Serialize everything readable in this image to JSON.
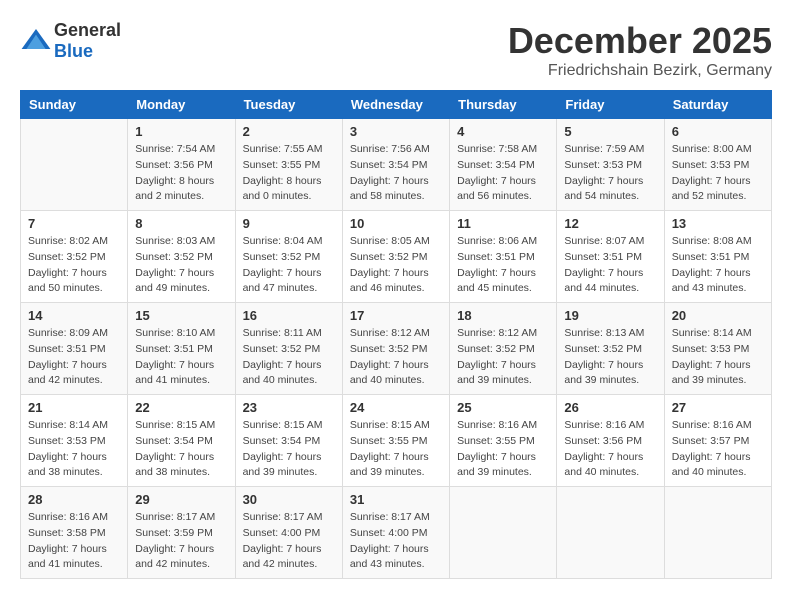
{
  "header": {
    "logo": {
      "general": "General",
      "blue": "Blue"
    },
    "month": "December 2025",
    "location": "Friedrichshain Bezirk, Germany"
  },
  "weekdays": [
    "Sunday",
    "Monday",
    "Tuesday",
    "Wednesday",
    "Thursday",
    "Friday",
    "Saturday"
  ],
  "weeks": [
    [
      {
        "day": "",
        "info": ""
      },
      {
        "day": "1",
        "info": "Sunrise: 7:54 AM\nSunset: 3:56 PM\nDaylight: 8 hours\nand 2 minutes."
      },
      {
        "day": "2",
        "info": "Sunrise: 7:55 AM\nSunset: 3:55 PM\nDaylight: 8 hours\nand 0 minutes."
      },
      {
        "day": "3",
        "info": "Sunrise: 7:56 AM\nSunset: 3:54 PM\nDaylight: 7 hours\nand 58 minutes."
      },
      {
        "day": "4",
        "info": "Sunrise: 7:58 AM\nSunset: 3:54 PM\nDaylight: 7 hours\nand 56 minutes."
      },
      {
        "day": "5",
        "info": "Sunrise: 7:59 AM\nSunset: 3:53 PM\nDaylight: 7 hours\nand 54 minutes."
      },
      {
        "day": "6",
        "info": "Sunrise: 8:00 AM\nSunset: 3:53 PM\nDaylight: 7 hours\nand 52 minutes."
      }
    ],
    [
      {
        "day": "7",
        "info": "Sunrise: 8:02 AM\nSunset: 3:52 PM\nDaylight: 7 hours\nand 50 minutes."
      },
      {
        "day": "8",
        "info": "Sunrise: 8:03 AM\nSunset: 3:52 PM\nDaylight: 7 hours\nand 49 minutes."
      },
      {
        "day": "9",
        "info": "Sunrise: 8:04 AM\nSunset: 3:52 PM\nDaylight: 7 hours\nand 47 minutes."
      },
      {
        "day": "10",
        "info": "Sunrise: 8:05 AM\nSunset: 3:52 PM\nDaylight: 7 hours\nand 46 minutes."
      },
      {
        "day": "11",
        "info": "Sunrise: 8:06 AM\nSunset: 3:51 PM\nDaylight: 7 hours\nand 45 minutes."
      },
      {
        "day": "12",
        "info": "Sunrise: 8:07 AM\nSunset: 3:51 PM\nDaylight: 7 hours\nand 44 minutes."
      },
      {
        "day": "13",
        "info": "Sunrise: 8:08 AM\nSunset: 3:51 PM\nDaylight: 7 hours\nand 43 minutes."
      }
    ],
    [
      {
        "day": "14",
        "info": "Sunrise: 8:09 AM\nSunset: 3:51 PM\nDaylight: 7 hours\nand 42 minutes."
      },
      {
        "day": "15",
        "info": "Sunrise: 8:10 AM\nSunset: 3:51 PM\nDaylight: 7 hours\nand 41 minutes."
      },
      {
        "day": "16",
        "info": "Sunrise: 8:11 AM\nSunset: 3:52 PM\nDaylight: 7 hours\nand 40 minutes."
      },
      {
        "day": "17",
        "info": "Sunrise: 8:12 AM\nSunset: 3:52 PM\nDaylight: 7 hours\nand 40 minutes."
      },
      {
        "day": "18",
        "info": "Sunrise: 8:12 AM\nSunset: 3:52 PM\nDaylight: 7 hours\nand 39 minutes."
      },
      {
        "day": "19",
        "info": "Sunrise: 8:13 AM\nSunset: 3:52 PM\nDaylight: 7 hours\nand 39 minutes."
      },
      {
        "day": "20",
        "info": "Sunrise: 8:14 AM\nSunset: 3:53 PM\nDaylight: 7 hours\nand 39 minutes."
      }
    ],
    [
      {
        "day": "21",
        "info": "Sunrise: 8:14 AM\nSunset: 3:53 PM\nDaylight: 7 hours\nand 38 minutes."
      },
      {
        "day": "22",
        "info": "Sunrise: 8:15 AM\nSunset: 3:54 PM\nDaylight: 7 hours\nand 38 minutes."
      },
      {
        "day": "23",
        "info": "Sunrise: 8:15 AM\nSunset: 3:54 PM\nDaylight: 7 hours\nand 39 minutes."
      },
      {
        "day": "24",
        "info": "Sunrise: 8:15 AM\nSunset: 3:55 PM\nDaylight: 7 hours\nand 39 minutes."
      },
      {
        "day": "25",
        "info": "Sunrise: 8:16 AM\nSunset: 3:55 PM\nDaylight: 7 hours\nand 39 minutes."
      },
      {
        "day": "26",
        "info": "Sunrise: 8:16 AM\nSunset: 3:56 PM\nDaylight: 7 hours\nand 40 minutes."
      },
      {
        "day": "27",
        "info": "Sunrise: 8:16 AM\nSunset: 3:57 PM\nDaylight: 7 hours\nand 40 minutes."
      }
    ],
    [
      {
        "day": "28",
        "info": "Sunrise: 8:16 AM\nSunset: 3:58 PM\nDaylight: 7 hours\nand 41 minutes."
      },
      {
        "day": "29",
        "info": "Sunrise: 8:17 AM\nSunset: 3:59 PM\nDaylight: 7 hours\nand 42 minutes."
      },
      {
        "day": "30",
        "info": "Sunrise: 8:17 AM\nSunset: 4:00 PM\nDaylight: 7 hours\nand 42 minutes."
      },
      {
        "day": "31",
        "info": "Sunrise: 8:17 AM\nSunset: 4:00 PM\nDaylight: 7 hours\nand 43 minutes."
      },
      {
        "day": "",
        "info": ""
      },
      {
        "day": "",
        "info": ""
      },
      {
        "day": "",
        "info": ""
      }
    ]
  ]
}
